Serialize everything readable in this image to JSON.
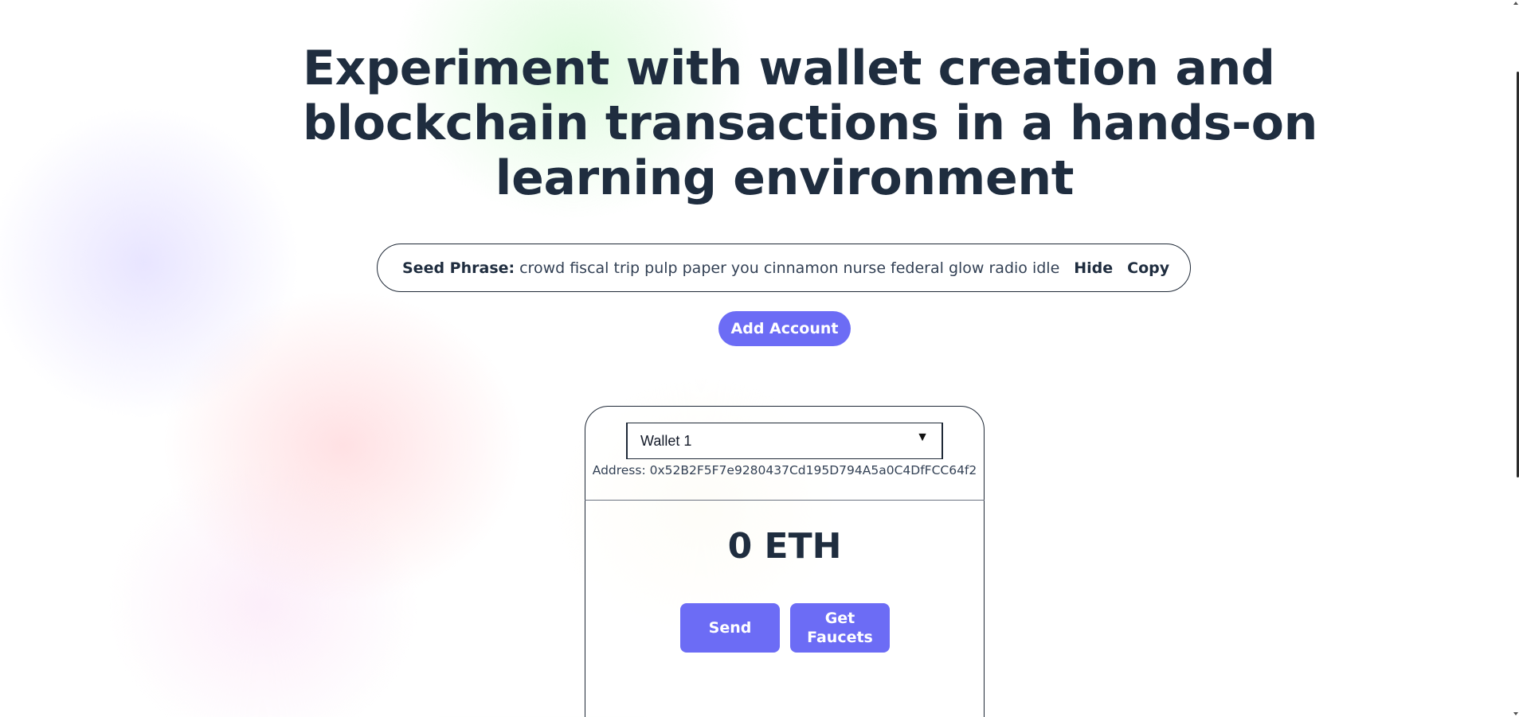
{
  "hero": {
    "title_lines": [
      "Experiment with wallet creation and",
      "blockchain transactions in a hands-on",
      "learning environment"
    ]
  },
  "seed": {
    "label": "Seed Phrase:",
    "phrase": "crowd fiscal trip pulp paper you cinnamon nurse federal glow radio idle",
    "hide_label": "Hide",
    "copy_label": "Copy"
  },
  "actions": {
    "add_account_label": "Add Account"
  },
  "wallet": {
    "selected": "Wallet 1",
    "caret_icon": "triangle-down-icon",
    "address_label": "Address:",
    "address": "0x52B2F5F7e9280437Cd195D794A5a0C4DfFCC64f2",
    "address_text": "Address: 0x52B2F5F7e9280437Cd195D794A5a0C4DfFCC64f2",
    "balance": "0 ETH",
    "send_label": "Send",
    "faucet_label": "Get Faucets"
  },
  "colors": {
    "accent": "#6c6cf5",
    "heading": "#1f2d3f"
  }
}
